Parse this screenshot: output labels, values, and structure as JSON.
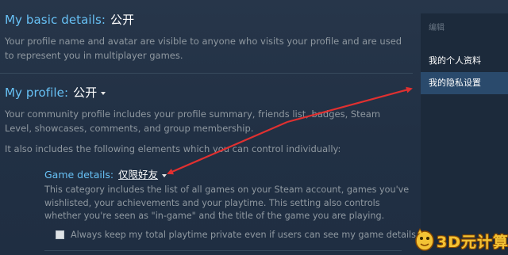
{
  "basic": {
    "label": "My basic details:",
    "value": "公开",
    "description": "Your profile name and avatar are visible to anyone who visits your profile and are used to represent you in multiplayer games."
  },
  "profile": {
    "label": "My profile:",
    "value": "公开",
    "description": "Your community profile includes your profile summary, friends list, badges, Steam Level, showcases, comments, and group membership.",
    "elements_intro": "It also includes the following elements which you can control individually:"
  },
  "game_details": {
    "label": "Game details:",
    "value": "仅限好友",
    "description": "This category includes the list of all games on your Steam account, games you've wishlisted, your achievements and your playtime. This setting also controls whether you're seen as \"in-game\" and the title of the game you are playing.",
    "checkbox_label": "Always keep my total playtime private even if users can see my game details.",
    "checkbox_checked": false
  },
  "sidebar": {
    "header": "编辑",
    "items": [
      {
        "label": "我的个人资料",
        "active": false
      },
      {
        "label": "我的隐私设置",
        "active": true
      }
    ]
  },
  "watermark": {
    "text": "3D元计算"
  },
  "colors": {
    "accent_blue": "#67c1f5",
    "annotation_arrow": "#e03030",
    "active_sidebar": "#2a4a6c"
  }
}
